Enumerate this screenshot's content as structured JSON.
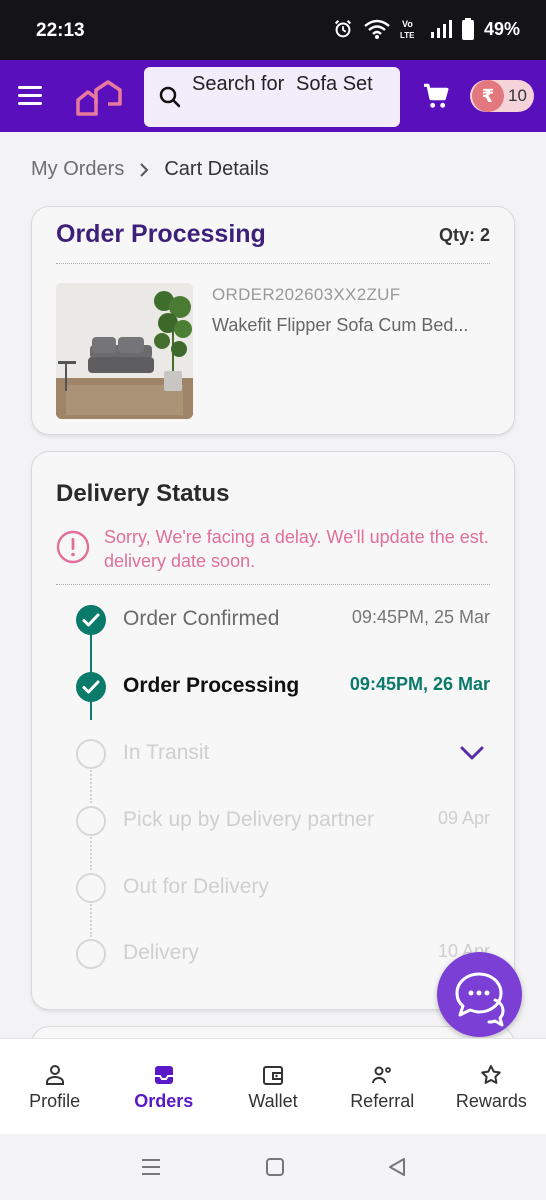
{
  "status_bar": {
    "time": "22:13",
    "battery": "49%",
    "icons": [
      "alarm-icon",
      "wifi-icon",
      "volte-icon",
      "signal-icon",
      "battery-icon"
    ]
  },
  "header": {
    "search_prefix": "Search for",
    "search_rotating": "Sofa Set",
    "coins": "10",
    "coin_symbol": "₹",
    "accent_color": "#5a0fbd"
  },
  "breadcrumb": {
    "parent": "My Orders",
    "current": "Cart Details"
  },
  "order_card": {
    "status": "Order Processing",
    "qty": "Qty: 2",
    "order_id": "ORDER202603XX2ZUF",
    "product_name": "Wakefit Flipper Sofa Cum Bed..."
  },
  "delivery": {
    "title": "Delivery Status",
    "delay_message": "Sorry, We're facing a delay. We'll update the est. delivery date soon.",
    "steps": [
      {
        "label": "Order Confirmed",
        "date": "09:45PM, 25 Mar",
        "state": "done"
      },
      {
        "label": "Order Processing",
        "date": "09:45PM, 26 Mar",
        "state": "current"
      },
      {
        "label": "In Transit",
        "date": "",
        "state": "todo"
      },
      {
        "label": "Pick up by Delivery partner",
        "date": "09 Apr",
        "state": "todo"
      },
      {
        "label": "Out for Delivery",
        "date": "",
        "state": "todo"
      },
      {
        "label": "Delivery",
        "date": "10 Apr",
        "state": "todo"
      }
    ]
  },
  "bottom_nav": {
    "items": [
      {
        "label": "Profile",
        "icon": "person-icon"
      },
      {
        "label": "Orders",
        "icon": "orders-icon",
        "active": true
      },
      {
        "label": "Wallet",
        "icon": "wallet-icon"
      },
      {
        "label": "Referral",
        "icon": "referral-icon"
      },
      {
        "label": "Rewards",
        "icon": "star-icon"
      }
    ]
  }
}
